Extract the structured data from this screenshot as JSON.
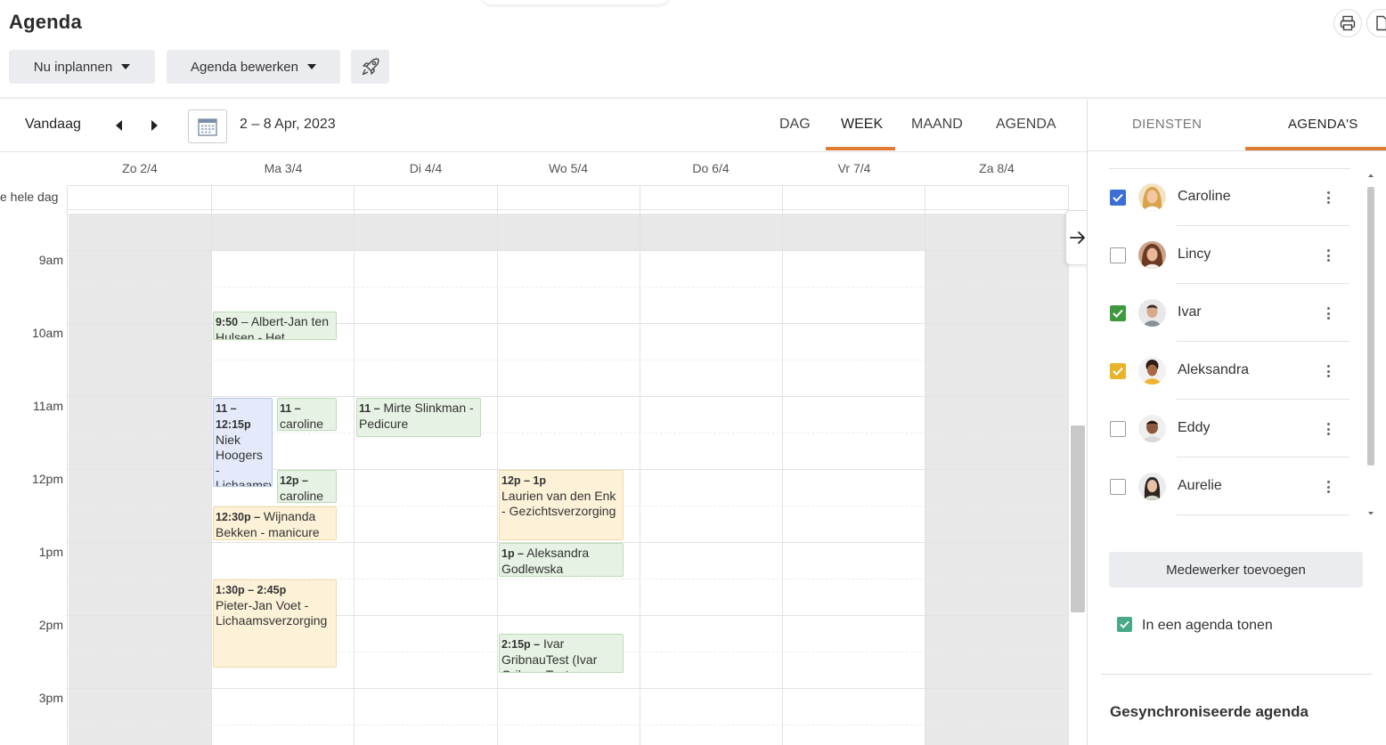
{
  "header": {
    "title": "Agenda",
    "schedule_button": "Nu inplannen",
    "edit_button": "Agenda bewerken",
    "icons": [
      "print-icon",
      "document-icon",
      "rocket-icon"
    ]
  },
  "toolbar": {
    "today": "Vandaag",
    "date_range": "2 – 8 Apr, 2023",
    "views": [
      "DAG",
      "WEEK",
      "MAAND",
      "AGENDA"
    ],
    "active_view": "WEEK"
  },
  "calendar": {
    "days": [
      "Zo 2/4",
      "Ma 3/4",
      "Di 4/4",
      "Wo 5/4",
      "Do 6/4",
      "Vr 7/4",
      "Za 8/4"
    ],
    "all_day_label": "e hele dag",
    "hours": [
      "9am",
      "10am",
      "11am",
      "12pm",
      "1pm",
      "2pm",
      "3pm"
    ],
    "events": [
      {
        "time": "9:50",
        "title": "Albert-Jan ten Hulsen - Het",
        "color": "green"
      },
      {
        "time": "11 – 12:15p",
        "title": "Niek Hoogers - Lichaamsverzorging",
        "color": "blue"
      },
      {
        "time": "11 –",
        "title": "caroline",
        "color": "green"
      },
      {
        "time": "11 –",
        "title": "Mirte Slinkman - Pedicure",
        "color": "green"
      },
      {
        "time": "12p –",
        "title": "caroline",
        "color": "green"
      },
      {
        "time": "12:30p –",
        "title": "Wijnanda Bekken - manicure",
        "color": "yellow"
      },
      {
        "time": "1:30p – 2:45p",
        "title": "Pieter-Jan Voet - Lichaamsverzorging",
        "color": "yellow"
      },
      {
        "time": "12p – 1p",
        "title": "Laurien van den Enk - Gezichtsverzorging",
        "color": "yellow"
      },
      {
        "time": "1p –",
        "title": "Aleksandra Godlewska",
        "color": "green"
      },
      {
        "time": "2:15p –",
        "title": "Ivar GribnauTest (Ivar GribnauTest",
        "color": "green"
      }
    ]
  },
  "panel": {
    "tabs": [
      "DIENSTEN",
      "AGENDA'S"
    ],
    "active_tab": "AGENDA'S",
    "staff": [
      {
        "name": "Caroline",
        "checked": true,
        "color": "#3b6fd6"
      },
      {
        "name": "Lincy",
        "checked": false,
        "color": ""
      },
      {
        "name": "Ivar",
        "checked": true,
        "color": "#3f9a3f"
      },
      {
        "name": "Aleksandra",
        "checked": true,
        "color": "#e9b32a"
      },
      {
        "name": "Eddy",
        "checked": false,
        "color": ""
      },
      {
        "name": "Aurelie",
        "checked": false,
        "color": ""
      }
    ],
    "add_button": "Medewerker toevoegen",
    "merge_label": "In een agenda tonen",
    "merge_checked": true,
    "sync_title": "Gesynchroniseerde agenda"
  },
  "colors": {
    "accent": "#e07b33",
    "event_green": "#e6f2e3",
    "event_blue": "#e4eafa",
    "event_yellow": "#fdf2d8"
  }
}
